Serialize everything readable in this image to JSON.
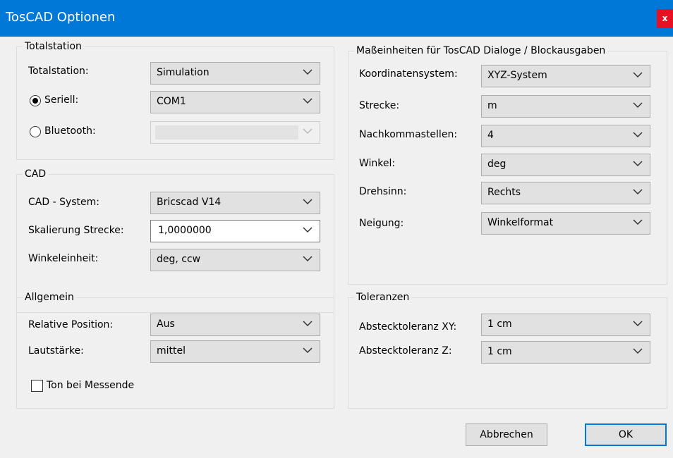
{
  "window": {
    "title": "TosCAD Optionen",
    "close_label": "x"
  },
  "totalstation": {
    "legend": "Totalstation",
    "station_label": "Totalstation:",
    "station_value": "Simulation",
    "seriell_label": "Seriell:",
    "seriell_selected": true,
    "seriell_value": "COM1",
    "bluetooth_label": "Bluetooth:",
    "bluetooth_value": ""
  },
  "cad": {
    "legend": "CAD",
    "system_label": "CAD - System:",
    "system_value": "Bricscad V14",
    "skalierung_label": "Skalierung Strecke:",
    "skalierung_value": "1,0000000",
    "winkeleinheit_label": "Winkeleinheit:",
    "winkeleinheit_value": "deg, ccw"
  },
  "allgemein": {
    "legend": "Allgemein",
    "relpos_label": "Relative Position:",
    "relpos_value": "Aus",
    "laut_label": "Lautstärke:",
    "laut_value": "mittel",
    "ton_label": "Ton bei Messende",
    "ton_checked": false
  },
  "einheiten": {
    "legend": "Maßeinheiten für TosCAD Dialoge / Blockausgaben",
    "koord_label": "Koordinatensystem:",
    "koord_value": "XYZ-System",
    "strecke_label": "Strecke:",
    "strecke_value": "m",
    "nachkomma_label": "Nachkommastellen:",
    "nachkomma_value": "4",
    "winkel_label": "Winkel:",
    "winkel_value": "deg",
    "drehsinn_label": "Drehsinn:",
    "drehsinn_value": "Rechts",
    "neigung_label": "Neigung:",
    "neigung_value": "Winkelformat"
  },
  "toleranzen": {
    "legend": "Toleranzen",
    "xy_label": "Abstecktoleranz XY:",
    "xy_value": "1 cm",
    "z_label": "Abstecktoleranz Z:",
    "z_value": "1 cm"
  },
  "buttons": {
    "cancel": "Abbrechen",
    "ok": "OK"
  },
  "icons": {
    "chevron": "chevron-down-icon",
    "close": "close-icon",
    "radio": "radio-icon",
    "checkbox": "checkbox-icon"
  }
}
